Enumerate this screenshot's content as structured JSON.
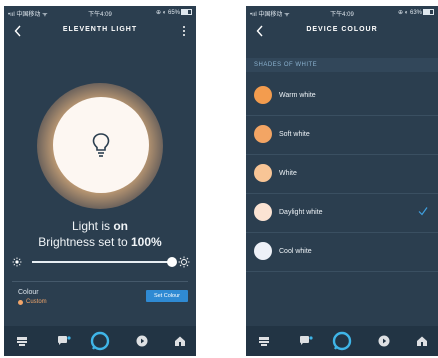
{
  "left": {
    "status": {
      "carrier": "•ııl 中国移动 ᯤ",
      "time": "下午4:09",
      "right": "⊕ ◐ 65%"
    },
    "header": {
      "title": "ELEVENTH LIGHT"
    },
    "light_state_prefix": "Light is ",
    "light_state": "on",
    "brightness_prefix": "Brightness set to ",
    "brightness": "100%",
    "brightness_level": 1.0,
    "colour": {
      "label": "Colour",
      "value": "Custom",
      "button": "Set Colour"
    }
  },
  "right": {
    "status": {
      "carrier": "•ııl 中国移动 ᯤ",
      "time": "下午4:09",
      "right": "⊕ ◐ 63%"
    },
    "header": {
      "title": "DEVICE COLOUR"
    },
    "section": "SHADES OF WHITE",
    "items": [
      {
        "label": "Warm white",
        "color": "#f39c4e"
      },
      {
        "label": "Soft white",
        "color": "#f3a564"
      },
      {
        "label": "White",
        "color": "#f8c596"
      },
      {
        "label": "Daylight white",
        "color": "#fbe3d3"
      },
      {
        "label": "Cool white",
        "color": "#eef1f8"
      }
    ],
    "selected": "Daylight white"
  },
  "colors": {
    "bg": "#2b3e4f",
    "accent": "#2f8ad3",
    "alexa": "#3fb5e8"
  }
}
